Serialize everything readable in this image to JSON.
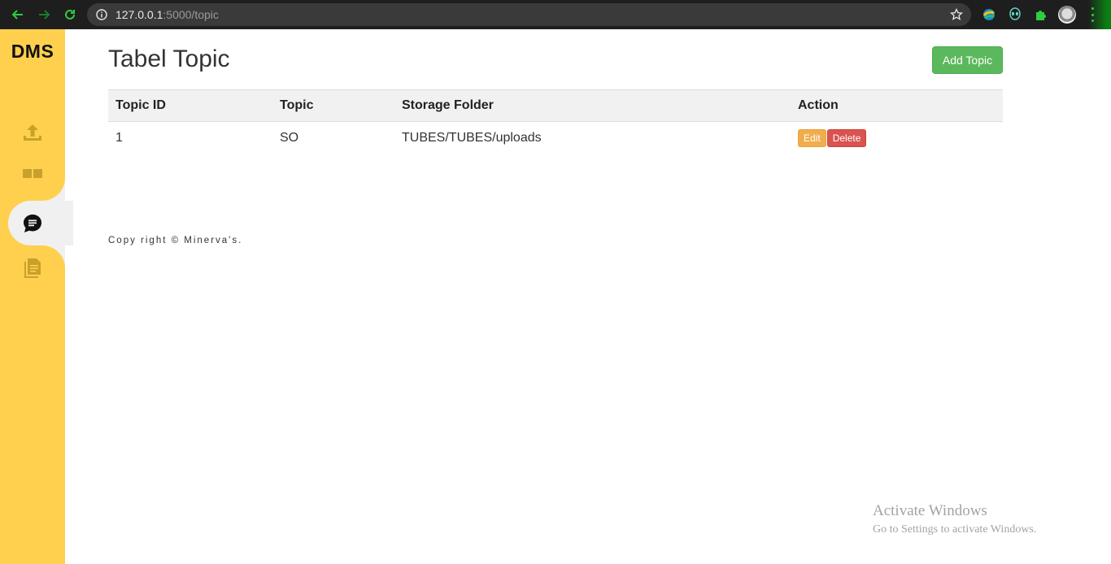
{
  "browser": {
    "url_host": "127.0.0.1",
    "url_path": ":5000/topic"
  },
  "sidebar": {
    "brand": "DMS",
    "items": [
      {
        "icon": "upload-icon"
      },
      {
        "icon": "dashboard-icon"
      },
      {
        "icon": "chat-icon",
        "active": true
      },
      {
        "icon": "documents-icon"
      }
    ],
    "bg_color": "#ffd04e"
  },
  "main": {
    "title": "Tabel Topic",
    "add_button": "Add Topic",
    "table": {
      "headers": [
        "Topic ID",
        "Topic",
        "Storage Folder",
        "Action"
      ],
      "rows": [
        {
          "id": "1",
          "topic": "SO",
          "folder": "TUBES/TUBES/uploads",
          "edit": "Edit",
          "delete": "Delete"
        }
      ]
    },
    "copyright": "Copy right © Minerva's."
  },
  "watermark": {
    "line1": "Activate Windows",
    "line2": "Go to Settings to activate Windows."
  }
}
